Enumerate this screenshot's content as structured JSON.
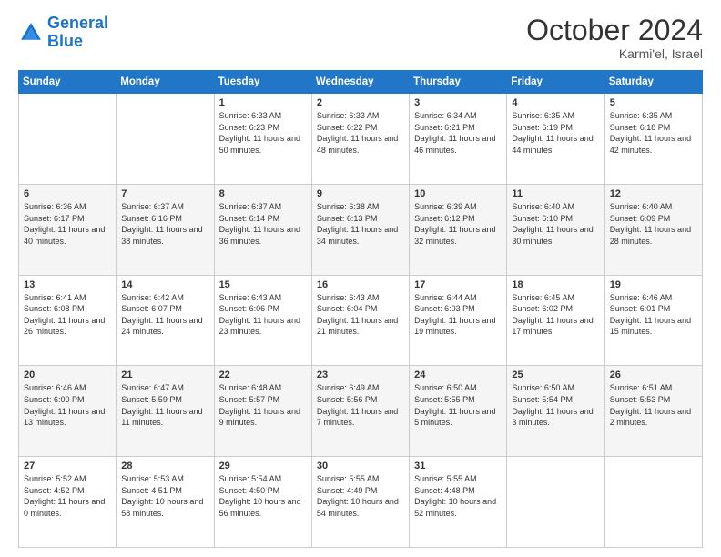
{
  "header": {
    "logo_line1": "General",
    "logo_line2": "Blue",
    "month": "October 2024",
    "location": "Karmi'el, Israel"
  },
  "weekdays": [
    "Sunday",
    "Monday",
    "Tuesday",
    "Wednesday",
    "Thursday",
    "Friday",
    "Saturday"
  ],
  "weeks": [
    [
      {
        "day": "",
        "info": ""
      },
      {
        "day": "",
        "info": ""
      },
      {
        "day": "1",
        "info": "Sunrise: 6:33 AM\nSunset: 6:23 PM\nDaylight: 11 hours and 50 minutes."
      },
      {
        "day": "2",
        "info": "Sunrise: 6:33 AM\nSunset: 6:22 PM\nDaylight: 11 hours and 48 minutes."
      },
      {
        "day": "3",
        "info": "Sunrise: 6:34 AM\nSunset: 6:21 PM\nDaylight: 11 hours and 46 minutes."
      },
      {
        "day": "4",
        "info": "Sunrise: 6:35 AM\nSunset: 6:19 PM\nDaylight: 11 hours and 44 minutes."
      },
      {
        "day": "5",
        "info": "Sunrise: 6:35 AM\nSunset: 6:18 PM\nDaylight: 11 hours and 42 minutes."
      }
    ],
    [
      {
        "day": "6",
        "info": "Sunrise: 6:36 AM\nSunset: 6:17 PM\nDaylight: 11 hours and 40 minutes."
      },
      {
        "day": "7",
        "info": "Sunrise: 6:37 AM\nSunset: 6:16 PM\nDaylight: 11 hours and 38 minutes."
      },
      {
        "day": "8",
        "info": "Sunrise: 6:37 AM\nSunset: 6:14 PM\nDaylight: 11 hours and 36 minutes."
      },
      {
        "day": "9",
        "info": "Sunrise: 6:38 AM\nSunset: 6:13 PM\nDaylight: 11 hours and 34 minutes."
      },
      {
        "day": "10",
        "info": "Sunrise: 6:39 AM\nSunset: 6:12 PM\nDaylight: 11 hours and 32 minutes."
      },
      {
        "day": "11",
        "info": "Sunrise: 6:40 AM\nSunset: 6:10 PM\nDaylight: 11 hours and 30 minutes."
      },
      {
        "day": "12",
        "info": "Sunrise: 6:40 AM\nSunset: 6:09 PM\nDaylight: 11 hours and 28 minutes."
      }
    ],
    [
      {
        "day": "13",
        "info": "Sunrise: 6:41 AM\nSunset: 6:08 PM\nDaylight: 11 hours and 26 minutes."
      },
      {
        "day": "14",
        "info": "Sunrise: 6:42 AM\nSunset: 6:07 PM\nDaylight: 11 hours and 24 minutes."
      },
      {
        "day": "15",
        "info": "Sunrise: 6:43 AM\nSunset: 6:06 PM\nDaylight: 11 hours and 23 minutes."
      },
      {
        "day": "16",
        "info": "Sunrise: 6:43 AM\nSunset: 6:04 PM\nDaylight: 11 hours and 21 minutes."
      },
      {
        "day": "17",
        "info": "Sunrise: 6:44 AM\nSunset: 6:03 PM\nDaylight: 11 hours and 19 minutes."
      },
      {
        "day": "18",
        "info": "Sunrise: 6:45 AM\nSunset: 6:02 PM\nDaylight: 11 hours and 17 minutes."
      },
      {
        "day": "19",
        "info": "Sunrise: 6:46 AM\nSunset: 6:01 PM\nDaylight: 11 hours and 15 minutes."
      }
    ],
    [
      {
        "day": "20",
        "info": "Sunrise: 6:46 AM\nSunset: 6:00 PM\nDaylight: 11 hours and 13 minutes."
      },
      {
        "day": "21",
        "info": "Sunrise: 6:47 AM\nSunset: 5:59 PM\nDaylight: 11 hours and 11 minutes."
      },
      {
        "day": "22",
        "info": "Sunrise: 6:48 AM\nSunset: 5:57 PM\nDaylight: 11 hours and 9 minutes."
      },
      {
        "day": "23",
        "info": "Sunrise: 6:49 AM\nSunset: 5:56 PM\nDaylight: 11 hours and 7 minutes."
      },
      {
        "day": "24",
        "info": "Sunrise: 6:50 AM\nSunset: 5:55 PM\nDaylight: 11 hours and 5 minutes."
      },
      {
        "day": "25",
        "info": "Sunrise: 6:50 AM\nSunset: 5:54 PM\nDaylight: 11 hours and 3 minutes."
      },
      {
        "day": "26",
        "info": "Sunrise: 6:51 AM\nSunset: 5:53 PM\nDaylight: 11 hours and 2 minutes."
      }
    ],
    [
      {
        "day": "27",
        "info": "Sunrise: 5:52 AM\nSunset: 4:52 PM\nDaylight: 11 hours and 0 minutes."
      },
      {
        "day": "28",
        "info": "Sunrise: 5:53 AM\nSunset: 4:51 PM\nDaylight: 10 hours and 58 minutes."
      },
      {
        "day": "29",
        "info": "Sunrise: 5:54 AM\nSunset: 4:50 PM\nDaylight: 10 hours and 56 minutes."
      },
      {
        "day": "30",
        "info": "Sunrise: 5:55 AM\nSunset: 4:49 PM\nDaylight: 10 hours and 54 minutes."
      },
      {
        "day": "31",
        "info": "Sunrise: 5:55 AM\nSunset: 4:48 PM\nDaylight: 10 hours and 52 minutes."
      },
      {
        "day": "",
        "info": ""
      },
      {
        "day": "",
        "info": ""
      }
    ]
  ]
}
